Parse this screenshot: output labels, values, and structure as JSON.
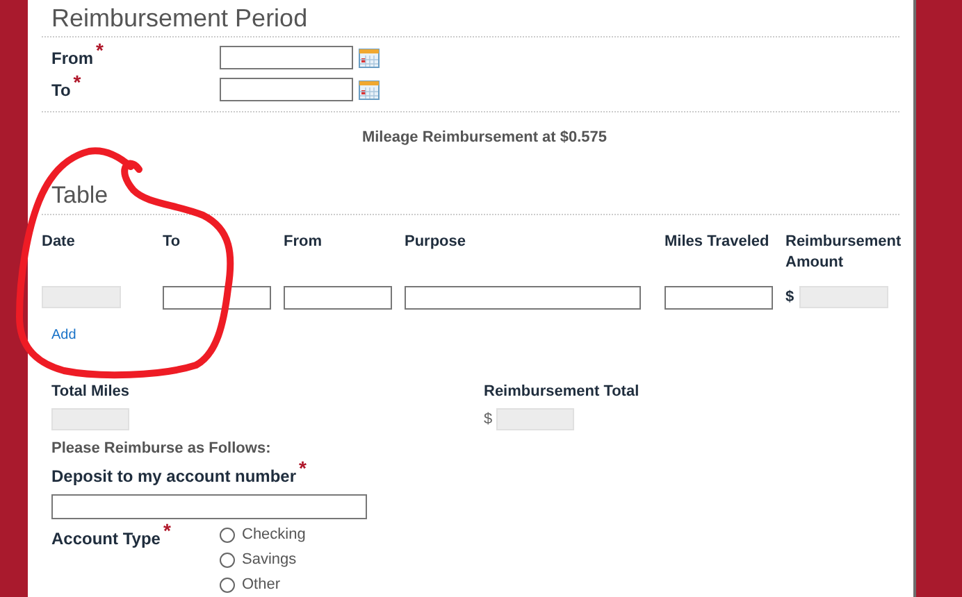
{
  "period": {
    "title": "Reimbursement Period",
    "fields": [
      {
        "label": "From",
        "required_mark": "*"
      },
      {
        "label": "To",
        "required_mark": "*"
      }
    ]
  },
  "rate_note": "Mileage Reimbursement at $0.575",
  "table": {
    "title": "Table",
    "columns": [
      {
        "label": "Date",
        "disabled": true
      },
      {
        "label": "To",
        "disabled": false
      },
      {
        "label": "From",
        "disabled": false
      },
      {
        "label": "Purpose",
        "disabled": false
      },
      {
        "label": "Miles Traveled",
        "disabled": false
      },
      {
        "label": "Reimbursement Amount",
        "disabled": true,
        "prefix": "$"
      }
    ],
    "add_link": "Add"
  },
  "totals": [
    {
      "label": "Total Miles"
    },
    {
      "label": "Reimbursement Total",
      "prefix": "$"
    }
  ],
  "payment": {
    "heading": "Please Reimburse as Follows:",
    "account_number": {
      "label": "Deposit to my account number",
      "required_mark": "*"
    },
    "account_type": {
      "label": "Account Type",
      "required_mark": "*",
      "options": [
        {
          "label": "Checking",
          "selected": false
        },
        {
          "label": "Savings",
          "selected": false
        },
        {
          "label": "Other",
          "selected": false
        }
      ]
    }
  }
}
